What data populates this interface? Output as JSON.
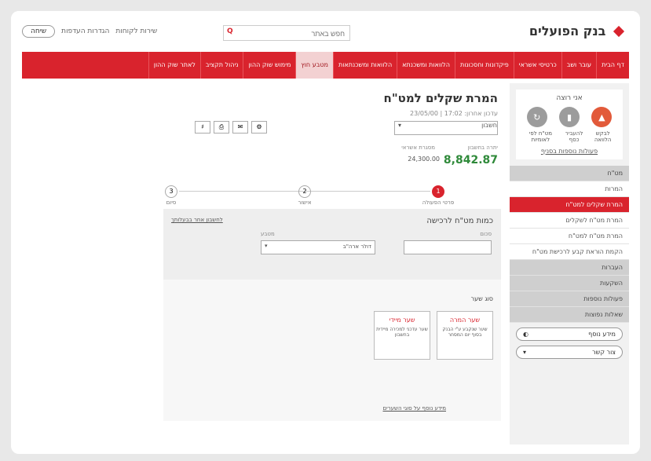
{
  "brand": {
    "name": "בנק הפועלים"
  },
  "top_utilities": {
    "button": "שיחה",
    "items": [
      "שירות לקוחות",
      "הגדרות העדפות"
    ]
  },
  "search": {
    "placeholder": "חפש באתר"
  },
  "nav": {
    "items": [
      {
        "label": "דף הבית",
        "active": false
      },
      {
        "label": "עובר ושב",
        "active": false
      },
      {
        "label": "כרטיסי אשראי",
        "active": false
      },
      {
        "label": "פיקדונות וחסכונות",
        "active": false
      },
      {
        "label": "הלוואות ומשכנתא",
        "active": false
      },
      {
        "label": "הלוואות ומשכנתאות",
        "active": false
      },
      {
        "label": "מטבע חוץ",
        "active": true
      },
      {
        "label": "מימוש שוק ההון",
        "active": false
      },
      {
        "label": "ניהול תקציב",
        "active": false
      },
      {
        "label": "לאתר שוק ההון",
        "active": false
      }
    ]
  },
  "sidebar": {
    "box_title": "אני רוצה",
    "circles": [
      {
        "label": "לבקש הלוואה",
        "color": "#e25a3a",
        "icon": "plus-icon"
      },
      {
        "label": "להעביר כסף",
        "color": "#9c9c9c",
        "icon": "transfer-icon"
      },
      {
        "label": "מט\"ח לפי לאומיות",
        "color": "#9c9c9c",
        "icon": "currency-icon"
      }
    ],
    "link": "פעולות נוספות בסניף",
    "groups": [
      {
        "label": "מט\"ח",
        "type": "head"
      },
      {
        "label": "המרות",
        "type": "sub"
      },
      {
        "label": "המרת שקלים למט\"ח",
        "type": "active"
      },
      {
        "label": "המרת מט\"ח לשקלים",
        "type": "sub"
      },
      {
        "label": "המרת מט\"ח למט\"ח",
        "type": "sub"
      },
      {
        "label": "הקמת הוראת קבע לרכישת מט\"ח",
        "type": "sub"
      },
      {
        "label": "העברות",
        "type": "head"
      },
      {
        "label": "השקעות",
        "type": "head"
      },
      {
        "label": "פעולות נוספות",
        "type": "head"
      },
      {
        "label": "שאלות נפוצות",
        "type": "head"
      }
    ],
    "pills": [
      "מידע נוסף",
      "צור קשר"
    ]
  },
  "main": {
    "title": "המרת שקלים למט\"ח",
    "subtitle": "עדכון אחרון: 17:02 | 23/05/00",
    "account_select": "חשבון",
    "amounts": {
      "available_label": "יתרה בחשבון",
      "available_value": "8,842.87",
      "frame_label": "מסגרת אשראי",
      "frame_value": "24,300.00"
    },
    "steps": [
      {
        "n": "1",
        "label": "פרטי הפעולה",
        "active": true
      },
      {
        "n": "2",
        "label": "אישור",
        "active": false
      },
      {
        "n": "3",
        "label": "סיום",
        "active": false
      }
    ],
    "form1": {
      "title": "כמות מט\"ח לרכישה",
      "link": "לחשבון אחר בבעלותך",
      "amount_label": "סכום",
      "currency_label": "מטבע",
      "currency_value": "דולר ארה\"ב"
    },
    "form2": {
      "title": "סוג שער",
      "cards": [
        {
          "title": "שער המרה",
          "desc": "שער שנקבע ע\"י הבנק בסוף יום המסחר"
        },
        {
          "title": "שער מיידי",
          "desc": "שער עדכני למכירה מיידית בחשבון"
        }
      ],
      "link": "מידע נוסף על סוגי השערים"
    }
  }
}
